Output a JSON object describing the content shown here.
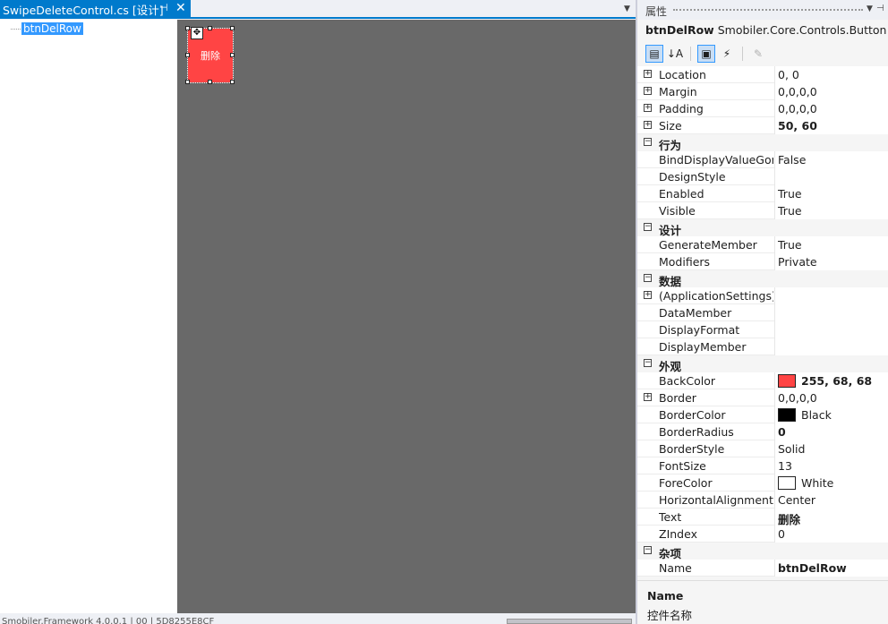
{
  "document_tab": {
    "title": "SwipeDeleteControl.cs [设计]",
    "pin_icon": "pin-icon",
    "close_icon": "close-icon"
  },
  "outline": {
    "item_label": "btnDelRow"
  },
  "designer": {
    "button_text": "删除",
    "button_color": "#ff4444",
    "canvas_color": "#696969"
  },
  "status": {
    "text": "Smobiler.Framework 4.0.0.1 | 00 | 5D8255E8CF"
  },
  "properties_panel": {
    "title": "属性",
    "object_name": "btnDelRow",
    "object_type": "Smobiler.Core.Controls.Button",
    "toolbar": {
      "categorized_icon": "categorized-icon",
      "alphabetical_icon": "alphabetical-icon",
      "properties_icon": "properties-icon",
      "events_icon": "lightning-icon",
      "property_pages_icon": "wrench-icon"
    },
    "rows": [
      {
        "kind": "prop",
        "expander": "+",
        "name": "Location",
        "value": "0, 0"
      },
      {
        "kind": "prop",
        "expander": "+",
        "name": "Margin",
        "value": "0,0,0,0"
      },
      {
        "kind": "prop",
        "expander": "+",
        "name": "Padding",
        "value": "0,0,0,0"
      },
      {
        "kind": "prop",
        "expander": "+",
        "name": "Size",
        "value": "50, 60",
        "bold": true
      },
      {
        "kind": "category",
        "expander": "−",
        "name": "行为"
      },
      {
        "kind": "prop",
        "name": "BindDisplayValueGone",
        "value": "False"
      },
      {
        "kind": "prop",
        "name": "DesignStyle",
        "value": ""
      },
      {
        "kind": "prop",
        "name": "Enabled",
        "value": "True"
      },
      {
        "kind": "prop",
        "name": "Visible",
        "value": "True"
      },
      {
        "kind": "category",
        "expander": "−",
        "name": "设计"
      },
      {
        "kind": "prop",
        "name": "GenerateMember",
        "value": "True"
      },
      {
        "kind": "prop",
        "name": "Modifiers",
        "value": "Private"
      },
      {
        "kind": "category",
        "expander": "−",
        "name": "数据"
      },
      {
        "kind": "prop",
        "expander": "+",
        "name": "(ApplicationSettings)",
        "value": ""
      },
      {
        "kind": "prop",
        "name": "DataMember",
        "value": ""
      },
      {
        "kind": "prop",
        "name": "DisplayFormat",
        "value": ""
      },
      {
        "kind": "prop",
        "name": "DisplayMember",
        "value": ""
      },
      {
        "kind": "category",
        "expander": "−",
        "name": "外观"
      },
      {
        "kind": "prop",
        "name": "BackColor",
        "value": "255, 68, 68",
        "bold": true,
        "swatch": "#ff4444"
      },
      {
        "kind": "prop",
        "expander": "+",
        "name": "Border",
        "value": "0,0,0,0"
      },
      {
        "kind": "prop",
        "name": "BorderColor",
        "value": "Black",
        "swatch": "#000000"
      },
      {
        "kind": "prop",
        "name": "BorderRadius",
        "value": "0",
        "bold": true
      },
      {
        "kind": "prop",
        "name": "BorderStyle",
        "value": "Solid"
      },
      {
        "kind": "prop",
        "name": "FontSize",
        "value": "13"
      },
      {
        "kind": "prop",
        "name": "ForeColor",
        "value": "White",
        "swatch": "#ffffff"
      },
      {
        "kind": "prop",
        "name": "HorizontalAlignment",
        "value": "Center"
      },
      {
        "kind": "prop",
        "name": "Text",
        "value": "删除",
        "bold": true
      },
      {
        "kind": "prop",
        "name": "ZIndex",
        "value": "0"
      },
      {
        "kind": "category",
        "expander": "−",
        "name": "杂项"
      },
      {
        "kind": "prop",
        "name": "Name",
        "value": "btnDelRow",
        "bold": true
      }
    ],
    "description": {
      "name": "Name",
      "text": "控件名称"
    }
  }
}
